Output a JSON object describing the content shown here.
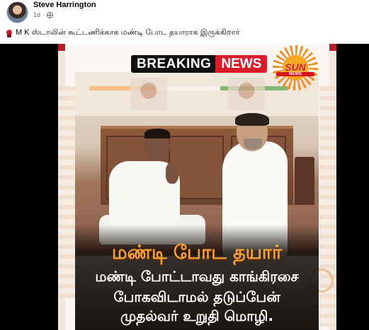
{
  "post": {
    "author": "Steve Harrington",
    "time": "1d",
    "audience_icon": "globe-icon",
    "caption_emoji": "red-emoji-icon",
    "caption": "M K ஸ்டாலின் கூட்டணிக்காக மண்டி போட தயாராக இருக்கிறார்"
  },
  "image": {
    "banner_left": "BREAKING",
    "banner_right": "NEWS",
    "logo_text": "SUN",
    "logo_sub": "NEWS",
    "headline": "மண்டி போட தயார்",
    "body_lines": [
      "மண்டி போட்டாவது காங்கிரசை",
      "போகவிடாமல் தடுப்பேன்",
      "முதல்வர் உறுதி மொழி."
    ],
    "colors": {
      "news_red": "#d71f2c",
      "headline_orange": "#f6a13a",
      "sun_orange": "#f28c1e"
    }
  }
}
